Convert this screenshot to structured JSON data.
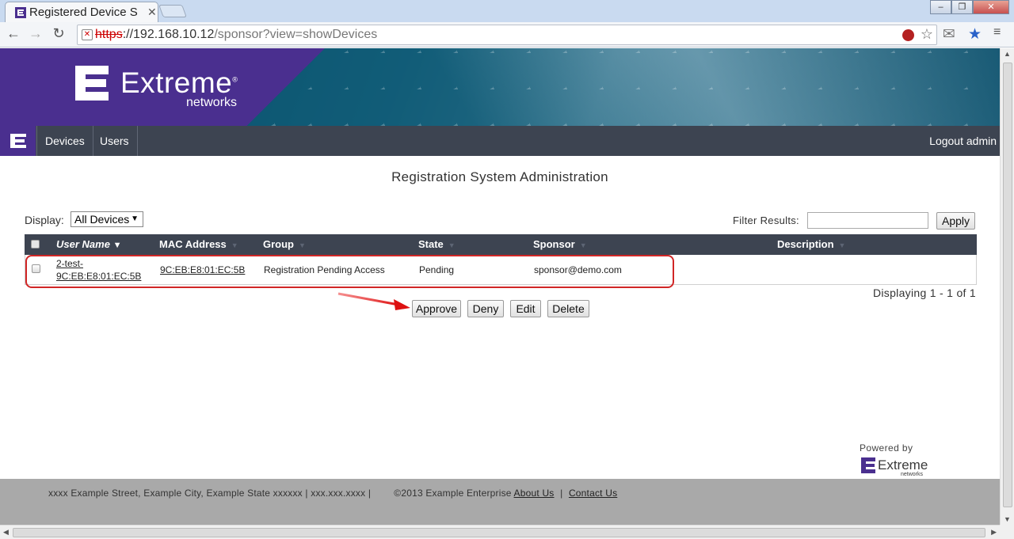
{
  "browser": {
    "tab_title": "Registered Device S",
    "url_scheme": "https",
    "url_rest": "://192.168.10.12",
    "url_path": "/sponsor?view=showDevices"
  },
  "header": {
    "brand": "Extreme",
    "brand_sub": "networks"
  },
  "nav": {
    "items": [
      {
        "label": "Devices"
      },
      {
        "label": "Users"
      }
    ],
    "logout": "Logout admin"
  },
  "page": {
    "title": "Registration System Administration",
    "display_label": "Display:",
    "display_value": "All Devices",
    "filter_label": "Filter Results:",
    "filter_value": "",
    "apply_label": "Apply"
  },
  "table": {
    "columns": [
      "User Name",
      "MAC Address",
      "Group",
      "State",
      "Sponsor",
      "Description"
    ],
    "rows": [
      {
        "user_name_line1": "2-test-",
        "user_name_line2": "9C:EB:E8:01:EC:5B",
        "mac": "9C:EB:E8:01:EC:5B",
        "group": "Registration Pending Access",
        "state": "Pending",
        "sponsor": "sponsor@demo.com",
        "description": ""
      }
    ],
    "paging": "Displaying 1 - 1 of 1"
  },
  "actions": {
    "approve": "Approve",
    "deny": "Deny",
    "edit": "Edit",
    "delete": "Delete"
  },
  "powered": {
    "label": "Powered by",
    "brand": "Extreme",
    "brand_sub": "networks"
  },
  "footer": {
    "address": "xxxx Example Street, Example City, Example State xxxxxx | xxx.xxx.xxxx |",
    "copyright": "©2013 Example Enterprise",
    "about": "About Us",
    "contact": "Contact Us"
  },
  "colors": {
    "brand_purple": "#4a2f8f",
    "nav_bg": "#3d4451",
    "highlight_red": "#d12626"
  }
}
